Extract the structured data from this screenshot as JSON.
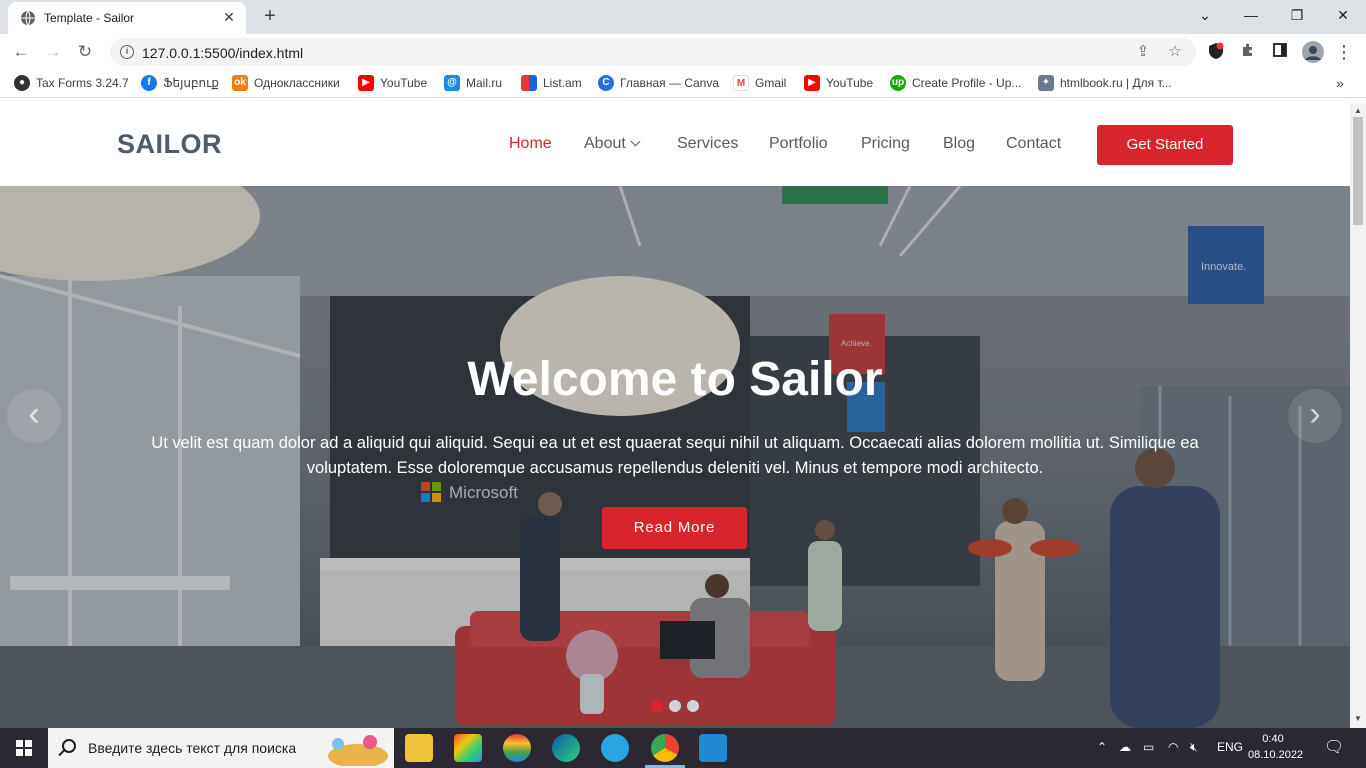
{
  "browser": {
    "tab_title": "Template - Sailor",
    "url": "127.0.0.1:5500/index.html",
    "bookmarks": [
      {
        "label": "Tax Forms 3.24.7",
        "icon": "github-icon",
        "color": "#333333"
      },
      {
        "label": "Ֆեյսբուք",
        "icon": "facebook-icon",
        "color": "#1877f2"
      },
      {
        "label": "Одноклассники",
        "icon": "odnoklassniki-icon",
        "color": "#ee8208"
      },
      {
        "label": "YouTube",
        "icon": "youtube-icon",
        "color": "#ff0000"
      },
      {
        "label": "Mail.ru",
        "icon": "mailru-icon",
        "color": "#168de2"
      },
      {
        "label": "List.am",
        "icon": "listam-icon",
        "color": "#f5a623"
      },
      {
        "label": "Главная — Canva",
        "icon": "canva-icon",
        "color": "#2b6ce5"
      },
      {
        "label": "Gmail",
        "icon": "gmail-icon",
        "color": "#ea4335"
      },
      {
        "label": "YouTube",
        "icon": "youtube-icon",
        "color": "#ff0000"
      },
      {
        "label": "Create Profile - Up...",
        "icon": "upwork-icon",
        "color": "#14a800"
      },
      {
        "label": "htmlbook.ru | Для т...",
        "icon": "htmlbook-icon",
        "color": "#6b7a90"
      }
    ]
  },
  "site": {
    "logo": "SAILOR",
    "nav": [
      {
        "label": "Home",
        "active": true
      },
      {
        "label": "About",
        "dropdown": true
      },
      {
        "label": "Services"
      },
      {
        "label": "Portfolio"
      },
      {
        "label": "Pricing"
      },
      {
        "label": "Blog"
      },
      {
        "label": "Contact"
      }
    ],
    "cta_label": "Get Started",
    "accent_color": "#d9232d"
  },
  "hero": {
    "title": "Welcome to Sailor",
    "text": "Ut velit est quam dolor ad a aliquid qui aliquid. Sequi ea ut et est quaerat sequi nihil ut aliquam. Occaecati alias dolorem mollitia ut. Similique ea voluptatem. Esse doloremque accusamus repellendus deleniti vel. Minus et tempore modi architecto.",
    "button_label": "Read More",
    "slides_total": 3,
    "active_slide": 1,
    "background_signage": {
      "brand": "Microsoft",
      "sign_1": "Achieve.",
      "sign_2": "Innovate."
    }
  },
  "taskbar": {
    "search_placeholder": "Введите здесь текст для поиска",
    "language": "ENG",
    "time": "0:40",
    "date": "08.10.2022"
  }
}
